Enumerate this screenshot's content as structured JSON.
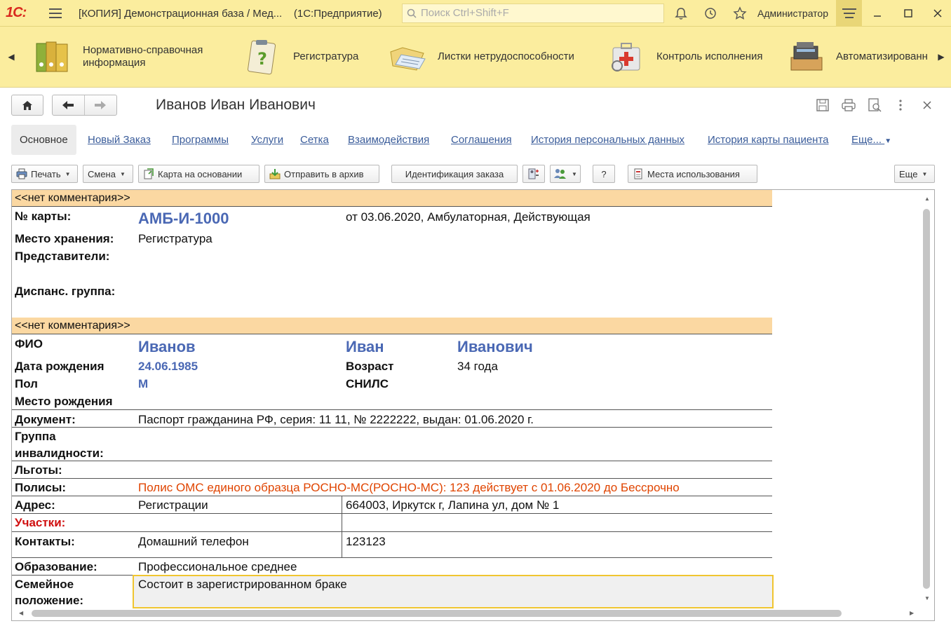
{
  "titlebar": {
    "logo": "1С:",
    "title": "[КОПИЯ] Демонстрационная база / Мед...",
    "app": "(1С:Предприятие)",
    "search_placeholder": "Поиск Ctrl+Shift+F",
    "user": "Администратор"
  },
  "sections": [
    {
      "label": "Нормативно-справочная информация",
      "icon": "binders-icon"
    },
    {
      "label": "Регистратура",
      "icon": "clipboard-question-icon"
    },
    {
      "label": "Листки нетрудоспособности",
      "icon": "folder-docs-icon"
    },
    {
      "label": "Контроль исполнения",
      "icon": "first-aid-kit-icon"
    },
    {
      "label": "Автоматизированная торговая точка",
      "icon": "cash-register-icon"
    }
  ],
  "document": {
    "title": "Иванов Иван Иванович"
  },
  "tabs": [
    "Основное",
    "Новый Заказ",
    "Программы",
    "Услуги",
    "Сетка",
    "Взаимодействия",
    "Соглашения",
    "История персональных данных",
    "История карты пациента",
    "Еще..."
  ],
  "commands": {
    "print": "Печать",
    "change": "Смена",
    "card_based": "Карта на основании",
    "archive": "Отправить в архив",
    "identify": "Идентификация заказа",
    "help": "?",
    "usage": "Места использования",
    "more": "Еще"
  },
  "report": {
    "comment1": "<<нет комментария>>",
    "card_no_label": "№ карты:",
    "card_no": "АМБ-И-1000",
    "card_info": "от 03.06.2020, Амбулаторная, Действующая",
    "storage_label": "Место хранения:",
    "storage": "Регистратура",
    "reps_label": "Представители:",
    "disp_label": "Диспанс. группа:",
    "comment2": "<<нет комментария>>",
    "fio_label": "ФИО",
    "last_name": "Иванов",
    "first_name": "Иван",
    "middle_name": "Иванович",
    "dob_label": "Дата рождения",
    "dob": "24.06.1985",
    "age_label": "Возраст",
    "age": "34 года",
    "sex_label": "Пол",
    "sex": "М",
    "snils_label": "СНИЛС",
    "birthplace_label": "Место рождения",
    "doc_label": "Документ:",
    "doc": "Паспорт гражданина РФ, серия: 11 11, № 2222222, выдан: 01.06.2020 г.",
    "disability_label1": "Группа",
    "disability_label2": "инвалидности:",
    "benefits_label": "Льготы:",
    "policies_label": "Полисы:",
    "policies": "Полис ОМС единого образца РОСНО-МС(РОСНО-МС): 123 действует с 01.06.2020 до Бессрочно",
    "address_label": "Адрес:",
    "address_type": "Регистрации",
    "address": "664003, Иркутск г, Лапина ул, дом № 1",
    "areas_label": "Участки:",
    "contacts_label": "Контакты:",
    "contact_type": "Домашний телефон",
    "contact": "123123",
    "education_label": "Образование:",
    "education": "Профессиональное среднее",
    "family_label1": "Семейное",
    "family_label2": "положение:",
    "family": "Состоит в зарегистрированном браке"
  }
}
